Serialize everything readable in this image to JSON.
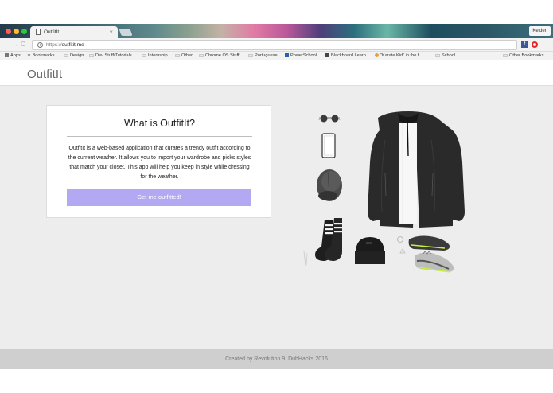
{
  "browser": {
    "tab": {
      "title": "OutfitIt",
      "close_glyph": "×"
    },
    "profile_name": "Kelden",
    "address": {
      "scheme": "https://",
      "host": "outfitit.me"
    },
    "nav_glyphs": {
      "back": "←",
      "forward": "→",
      "reload": "C"
    },
    "extensions": {
      "facebook_letter": "f"
    }
  },
  "bookmarks": {
    "apps": "Apps",
    "items": [
      {
        "label": "Bookmarks",
        "icon": "star-icon"
      },
      {
        "label": "Design",
        "icon": "folder-icon"
      },
      {
        "label": "Dev Stuff/Tutorials",
        "icon": "folder-icon"
      },
      {
        "label": "Internship",
        "icon": "folder-icon"
      },
      {
        "label": "Other",
        "icon": "folder-icon"
      },
      {
        "label": "Chrome OS Stuff",
        "icon": "folder-icon"
      },
      {
        "label": "Portuguese",
        "icon": "folder-icon"
      },
      {
        "label": "PowerSchool",
        "icon": "powerschool-icon"
      },
      {
        "label": "Blackboard Learn",
        "icon": "blackboard-icon"
      },
      {
        "label": "\"Karate Kid\" in the f...",
        "icon": "page-icon"
      },
      {
        "label": "School",
        "icon": "folder-icon"
      }
    ],
    "other": "Other Bookmarks"
  },
  "site": {
    "logo": "OutfitIt",
    "card": {
      "title": "What is OutfitIt?",
      "description": "OutfitIt is a web-based application that curates a trendy outfit according to the current weather. It allows you to import your wardrobe and picks styles that match your closet. This app will help you keep in style while dressing for the weather.",
      "button_label": "Get me outfitted!"
    },
    "footer": "Created by Revolution 9, DubHacks 2016"
  },
  "colors": {
    "accent_button": "#b3a9f3",
    "page_background": "#ededed",
    "footer_background": "#cfcfcf"
  }
}
